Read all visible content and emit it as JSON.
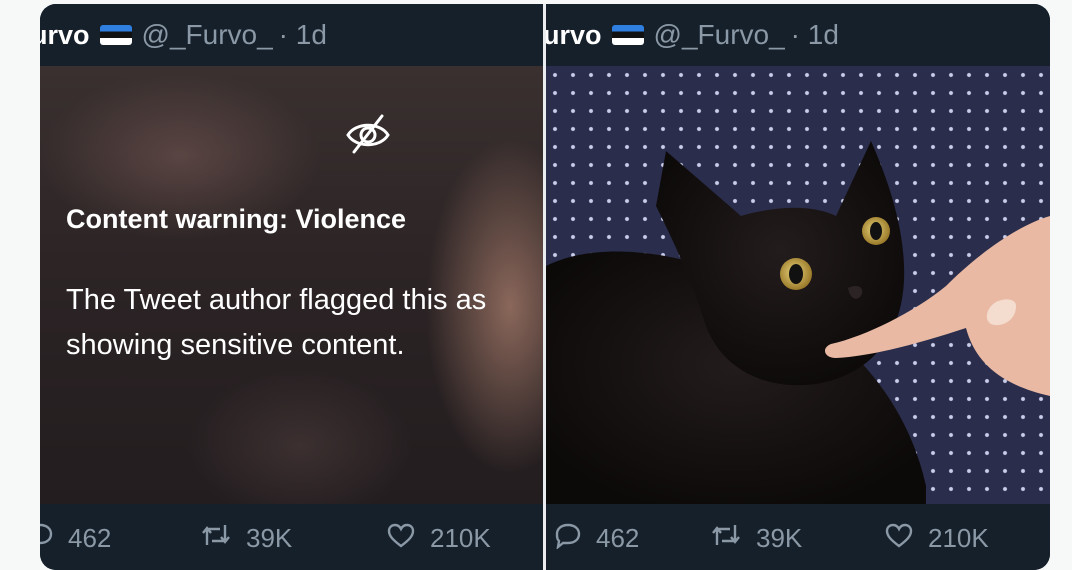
{
  "colors": {
    "tweet_background": "#15202b",
    "muted_text": "#8b98a5",
    "primary_text": "#ffffff"
  },
  "left_tweet": {
    "display_name": "urvo",
    "flag_icon": "estonia-flag-icon",
    "handle": "@_Furvo_",
    "time": "· 1d",
    "warning_title": "Content warning: Violence",
    "warning_body": "The Tweet author flagged this as showing sensitive content.",
    "replies": "462",
    "retweets": "39K",
    "likes": "210K"
  },
  "right_tweet": {
    "display_name": "urvo",
    "flag_icon": "estonia-flag-icon",
    "handle": "@_Furvo_",
    "time": "· 1d",
    "photo": "black-cat-biting-finger-photo",
    "replies": "462",
    "retweets": "39K",
    "likes": "210K"
  }
}
